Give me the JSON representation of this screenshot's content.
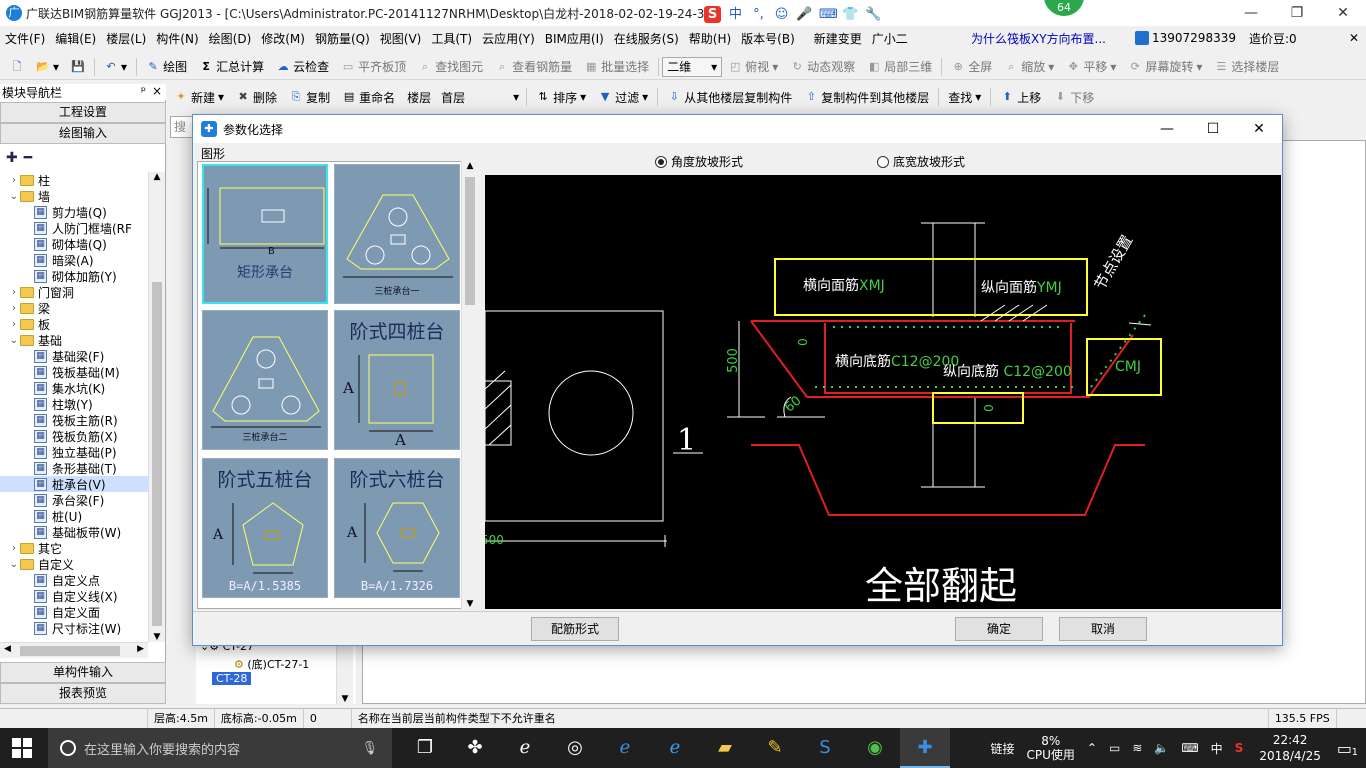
{
  "window": {
    "title": "广联达BIM钢筋算量软件 GGJ2013 - [C:\\Users\\Administrator.PC-20141127NRHM\\Desktop\\白龙村-2018-02-02-19-24-35",
    "badge": "64",
    "min": "—",
    "restore": "❐",
    "close": "✕"
  },
  "ime": {
    "logo": "S",
    "lang": "中",
    "punct": "°,",
    "face": "☺",
    "mic": "🎤",
    "keyboard": "⌨",
    "skin": "👕",
    "tools": "🔧"
  },
  "menu": {
    "items": [
      "文件(F)",
      "编辑(E)",
      "楼层(L)",
      "构件(N)",
      "绘图(D)",
      "修改(M)",
      "钢筋量(Q)",
      "视图(V)",
      "工具(T)",
      "云应用(Y)",
      "BIM应用(I)",
      "在线服务(S)",
      "帮助(H)",
      "版本号(B)",
      "新建变更",
      "广小二"
    ],
    "question": "为什么筏板XY方向布置...",
    "phone": "13907298339",
    "price": "造价豆:0",
    "close": "✕"
  },
  "toolbar1": {
    "draw": "绘图",
    "sum": "汇总计算",
    "cloud_check": "云检查",
    "align_top": "平齐板顶",
    "find_elem": "查找图元",
    "view_rebar": "查看钢筋量",
    "batch_select": "批量选择",
    "view_mode": "二维",
    "top_view": "俯视",
    "dynamic": "动态观察",
    "local3d": "局部三维",
    "fullscreen": "全屏",
    "zoom": "缩放",
    "pan": "平移",
    "rotate": "屏幕旋转",
    "select_floor": "选择楼层"
  },
  "toolbar2": {
    "new": "新建",
    "delete": "删除",
    "copy": "复制",
    "rename": "重命名",
    "floor_label": "楼层",
    "floor_value": "首层",
    "sort": "排序",
    "filter": "过滤",
    "copy_from": "从其他楼层复制构件",
    "copy_to": "复制构件到其他楼层",
    "find": "查找",
    "move_up": "上移",
    "move_down": "下移",
    "search_ph": "搜索"
  },
  "nav": {
    "header": "模块导航栏",
    "pin": "ᵖ",
    "close": "×",
    "project_settings": "工程设置",
    "drawing_input": "绘图输入",
    "single_input": "单构件输入",
    "report_preview": "报表预览",
    "tree": [
      {
        "level": 0,
        "toggle": "›",
        "type": "folder",
        "label": "柱"
      },
      {
        "level": 0,
        "toggle": "⌄",
        "type": "folder",
        "label": "墙"
      },
      {
        "level": 1,
        "type": "leaf",
        "label": "剪力墙(Q)"
      },
      {
        "level": 1,
        "type": "leaf",
        "label": "人防门框墙(RF"
      },
      {
        "level": 1,
        "type": "leaf",
        "label": "砌体墙(Q)"
      },
      {
        "level": 1,
        "type": "leaf",
        "label": "暗梁(A)"
      },
      {
        "level": 1,
        "type": "leaf",
        "label": "砌体加筋(Y)"
      },
      {
        "level": 0,
        "toggle": "›",
        "type": "folder",
        "label": "门窗洞"
      },
      {
        "level": 0,
        "toggle": "›",
        "type": "folder",
        "label": "梁"
      },
      {
        "level": 0,
        "toggle": "›",
        "type": "folder",
        "label": "板"
      },
      {
        "level": 0,
        "toggle": "⌄",
        "type": "folder",
        "label": "基础"
      },
      {
        "level": 1,
        "type": "leaf",
        "label": "基础梁(F)"
      },
      {
        "level": 1,
        "type": "leaf",
        "label": "筏板基础(M)"
      },
      {
        "level": 1,
        "type": "leaf",
        "label": "集水坑(K)"
      },
      {
        "level": 1,
        "type": "leaf",
        "label": "柱墩(Y)"
      },
      {
        "level": 1,
        "type": "leaf",
        "label": "筏板主筋(R)"
      },
      {
        "level": 1,
        "type": "leaf",
        "label": "筏板负筋(X)"
      },
      {
        "level": 1,
        "type": "leaf",
        "label": "独立基础(P)"
      },
      {
        "level": 1,
        "type": "leaf",
        "label": "条形基础(T)"
      },
      {
        "level": 1,
        "type": "leaf",
        "label": "桩承台(V)",
        "selected": true
      },
      {
        "level": 1,
        "type": "leaf",
        "label": "承台梁(F)"
      },
      {
        "level": 1,
        "type": "leaf",
        "label": "桩(U)"
      },
      {
        "level": 1,
        "type": "leaf",
        "label": "基础板带(W)"
      },
      {
        "level": 0,
        "toggle": "›",
        "type": "folder",
        "label": "其它"
      },
      {
        "level": 0,
        "toggle": "⌄",
        "type": "folder",
        "label": "自定义"
      },
      {
        "level": 1,
        "type": "leaf",
        "label": "自定义点"
      },
      {
        "level": 1,
        "type": "leaf",
        "label": "自定义线(X)"
      },
      {
        "level": 1,
        "type": "leaf",
        "label": "自定义面"
      },
      {
        "level": 1,
        "type": "leaf",
        "label": "尺寸标注(W)"
      }
    ]
  },
  "component_list": {
    "items": [
      {
        "label": "CT-27"
      },
      {
        "label": "(底)CT-27-1"
      },
      {
        "label": "CT-28",
        "selected": true
      }
    ]
  },
  "main_view": {
    "label_1": "1",
    "dim_500": "500"
  },
  "status": {
    "floor_height": "层高:4.5m",
    "bottom_elev": "底标高:-0.05m",
    "zero": "0",
    "message": "名称在当前层当前构件类型下不允许重名",
    "fps": "135.5 FPS"
  },
  "taskbar": {
    "search_ph": "在这里输入你要搜索的内容",
    "link": "链接",
    "cpu_pct": "8%",
    "cpu_label": "CPU使用",
    "lang": "中",
    "time": "22:42",
    "date": "2018/4/25",
    "notif": "1"
  },
  "dialog": {
    "title": "参数化选择",
    "shape_label": "图形",
    "radio_angle": "角度放坡形式",
    "radio_width": "底宽放坡形式",
    "angle_selected": true,
    "btn_rebar": "配筋形式",
    "btn_ok": "确定",
    "btn_cancel": "取消",
    "shapes": [
      {
        "name": "矩形承台",
        "dim": "B"
      },
      {
        "name": "三桩承台一"
      },
      {
        "name": "三桩承台二"
      },
      {
        "name": "阶式四桩台",
        "dim": "A"
      },
      {
        "name": "阶式五桩台",
        "dim": "A",
        "formula": "B=A/1.5385"
      },
      {
        "name": "阶式六桩台",
        "dim": "A",
        "formula": "B=A/1.7326"
      }
    ]
  },
  "cad": {
    "transverse_top": "横向面筋",
    "transverse_top_code": "XMJ",
    "longitudinal_top": "纵向面筋",
    "longitudinal_top_code": "YMJ",
    "node_setting": "节点设置",
    "transverse_bottom": "横向底筋",
    "transverse_bottom_val": "C12@200",
    "longitudinal_bottom": "纵向底筋",
    "longitudinal_bottom_val": "C12@200",
    "cmj": "CMJ",
    "dim_500": "500",
    "angle": "60",
    "zero_a": "0",
    "zero_b": "0",
    "caption": "全部翻起"
  }
}
